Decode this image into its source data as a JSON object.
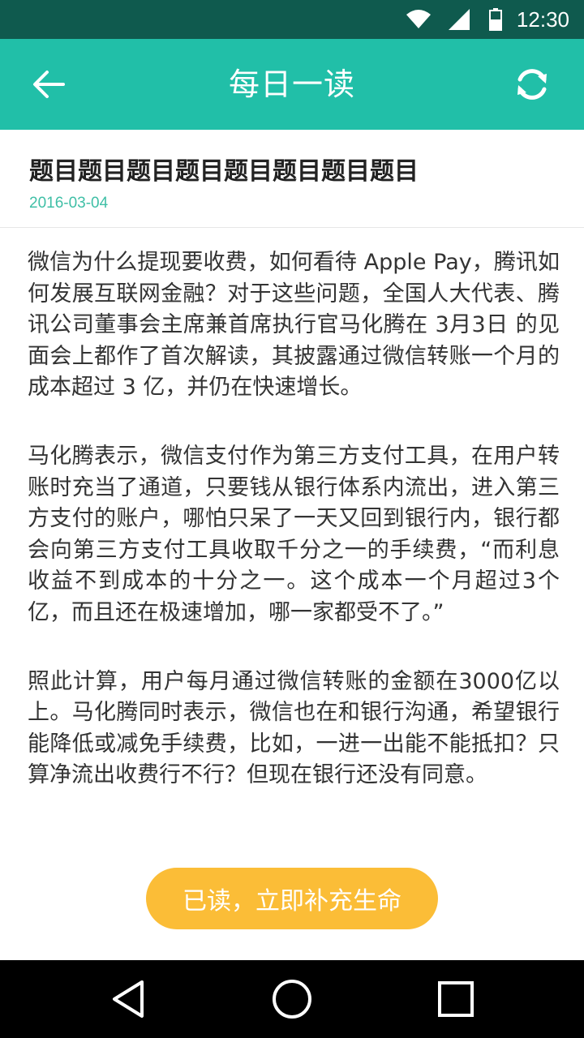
{
  "status_bar": {
    "time": "12:30"
  },
  "app_bar": {
    "title": "每日一读",
    "back_icon": "arrow-left-icon",
    "refresh_icon": "refresh-icon"
  },
  "article": {
    "title": "题目题目题目题目题目题目题目题目",
    "date": "2016-03-04",
    "paragraphs": [
      "微信为什么提现要收费，如何看待 Apple Pay，腾讯如何发展互联网金融？对于这些问题，全国人大代表、腾讯公司董事会主席兼首席执行官马化腾在 3月3日 的见面会上都作了首次解读，其披露通过微信转账一个月的成本超过 3 亿，并仍在快速增长。",
      "马化腾表示，微信支付作为第三方支付工具，在用户转账时充当了通道，只要钱从银行体系内流出，进入第三方支付的账户，哪怕只呆了一天又回到银行内，银行都会向第三方支付工具收取千分之一的手续费，“而利息收益不到成本的十分之一。这个成本一个月超过3个亿，而且还在极速增加，哪一家都受不了。”",
      "照此计算，用户每月通过微信转账的金额在3000亿以上。马化腾同时表示，微信也在和银行沟通，希望银行能降低或减免手续费，比如，一进一出能不能抵扣？只算净流出收费行不行？但现在银行还没有同意。"
    ]
  },
  "action": {
    "read_button": "已读，立即补充生命"
  },
  "colors": {
    "status_bar": "#0f5a4e",
    "app_bar": "#21bfa8",
    "date": "#3fbfa6",
    "button": "#fbbd37"
  },
  "nav_bar": {
    "icons": [
      "back-triangle-icon",
      "home-circle-icon",
      "recents-square-icon"
    ]
  }
}
